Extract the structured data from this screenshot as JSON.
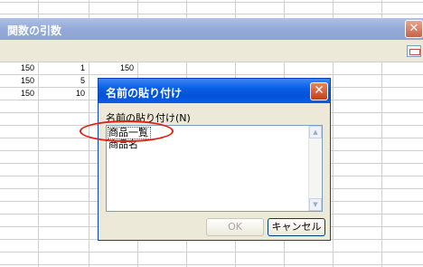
{
  "spreadsheet": {
    "rows": [
      [
        "150",
        "1",
        "150"
      ],
      [
        "150",
        "5",
        ""
      ],
      [
        "150",
        "10",
        ""
      ]
    ]
  },
  "function_args_dialog": {
    "title": "関数の引数",
    "close_glyph": "✕"
  },
  "paste_name_dialog": {
    "title": "名前の貼り付け",
    "close_glyph": "✕",
    "list_label": "名前の貼り付け(N)",
    "items": [
      "商品一覧",
      "商品名"
    ],
    "selected_index": 0,
    "scroll_up_glyph": "▲",
    "scroll_down_glyph": "▼",
    "ok_label": "OK",
    "cancel_label": "キャンセル"
  },
  "colors": {
    "annotation": "#e02010",
    "dialog_title": "#0a5ee6"
  }
}
